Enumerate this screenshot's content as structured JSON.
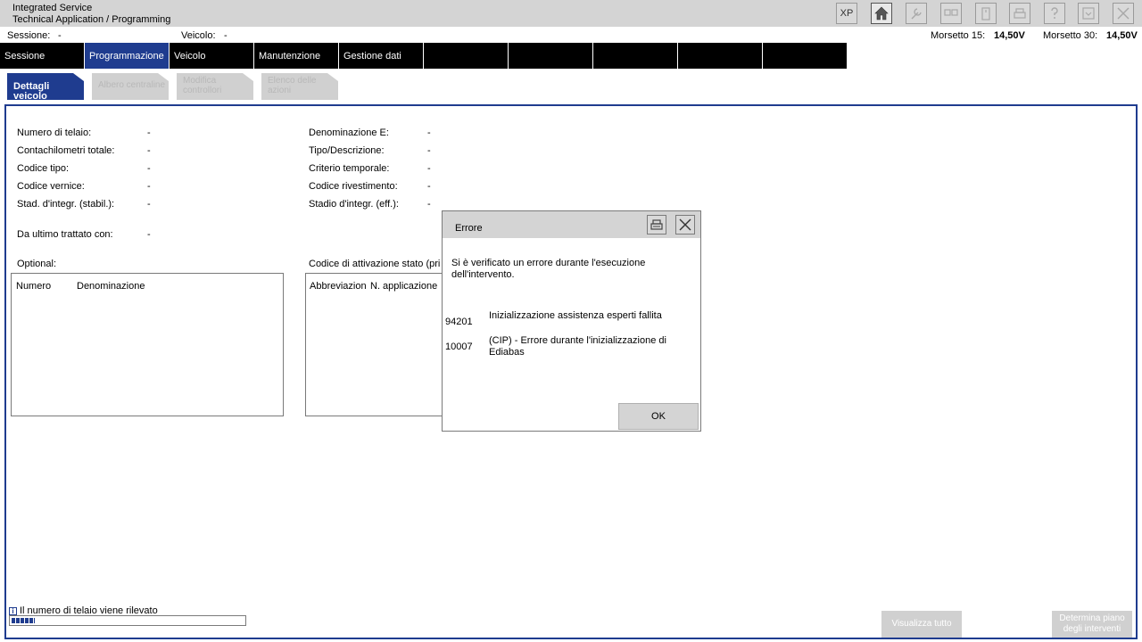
{
  "app": {
    "title_line1": "Integrated Service",
    "title_line2": "Technical Application / Programming"
  },
  "toolbar": {
    "xp_label": "XP",
    "icons": [
      "home-icon",
      "wrench-icon",
      "display-icon",
      "plug-icon",
      "printer-icon",
      "help-icon",
      "minimize-icon",
      "close-icon"
    ]
  },
  "session": {
    "session_label": "Sessione:",
    "session_value": "-",
    "vehicle_label": "Veicolo:",
    "vehicle_value": "-",
    "term15_label": "Morsetto 15:",
    "term15_value": "14,50V",
    "term30_label": "Morsetto 30:",
    "term30_value": "14,50V"
  },
  "nav": {
    "items": [
      "Sessione",
      "Programmazione",
      "Veicolo",
      "Manutenzione",
      "Gestione dati",
      "",
      "",
      "",
      "",
      ""
    ],
    "active_index": 1
  },
  "subtabs": {
    "items": [
      "Dettagli veicolo",
      "Albero centraline",
      "Modifica\ncontrollori",
      "Elenco delle\nazioni"
    ]
  },
  "details": {
    "left": [
      {
        "label": "Numero di telaio:",
        "value": "-"
      },
      {
        "label": "Contachilometri totale:",
        "value": "-"
      },
      {
        "label": "Codice tipo:",
        "value": "-"
      },
      {
        "label": "Codice vernice:",
        "value": "-"
      },
      {
        "label": "Stad. d'integr. (stabil.):",
        "value": "-"
      },
      {
        "label": "Da ultimo trattato con:",
        "value": "-"
      }
    ],
    "right": [
      {
        "label": "Denominazione E:",
        "value": "-"
      },
      {
        "label": "Tipo/Descrizione:",
        "value": "-"
      },
      {
        "label": "Criterio temporale:",
        "value": "-"
      },
      {
        "label": "Codice rivestimento:",
        "value": "-"
      },
      {
        "label": "Stadio d'integr. (eff.):",
        "value": "-"
      }
    ]
  },
  "optional": {
    "title": "Optional:",
    "col1": "Numero",
    "col2": "Denominazione"
  },
  "activation": {
    "title": "Codice di attivazione stato (pri",
    "col1": "Abbreviazion",
    "col2": "N. applicazione"
  },
  "status": {
    "info_icon": "i",
    "message": "Il numero di telaio viene rilevato",
    "progress": 0.1
  },
  "buttons": {
    "show_all": "Visualizza tutto",
    "plan_line1": "Determina piano",
    "plan_line2": "degli interventi"
  },
  "dialog": {
    "title": "Errore",
    "message": "Si è verificato un errore durante l'esecuzione dell'intervento.",
    "errors": [
      {
        "code": "94201",
        "text": "Inizializzazione assistenza esperti fallita"
      },
      {
        "code": "10007",
        "text": "(CIP) - Errore durante l'inizializzazione di Ediabas"
      }
    ],
    "ok_label": "OK"
  }
}
